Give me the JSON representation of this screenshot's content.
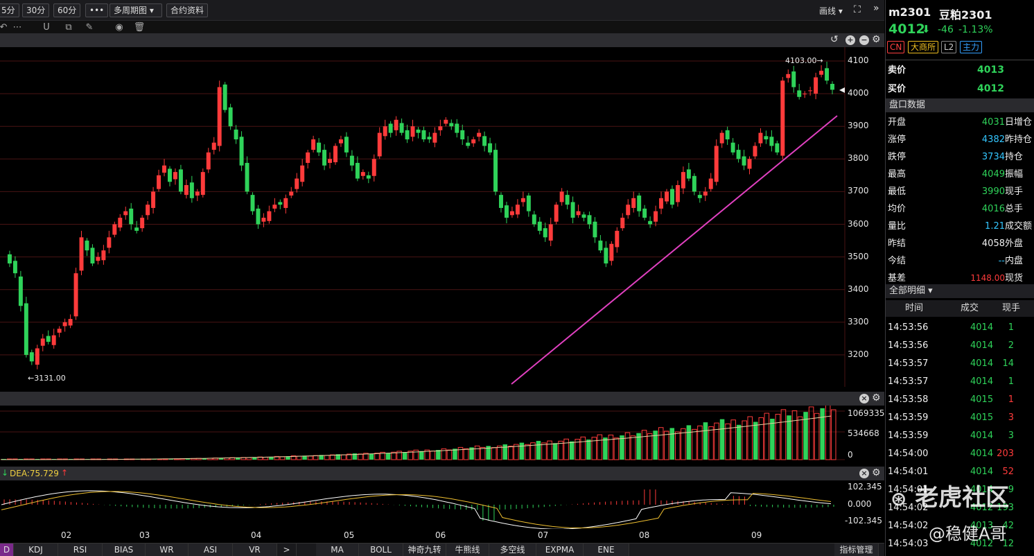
{
  "toolbar": {
    "buttons": [
      "5分",
      "30分",
      "60分",
      "•••",
      "多周期图",
      "合约资料"
    ],
    "draw_label": "画线",
    "more_label": "»"
  },
  "main_chart": {
    "price_ticks": [
      "4100",
      "4000",
      "3900",
      "3800",
      "3700",
      "3600",
      "3500",
      "3400",
      "3300",
      "3200"
    ],
    "high_label": "4103.00",
    "low_label": "3131.00",
    "x_ticks": [
      "02",
      "03",
      "04",
      "05",
      "06",
      "07",
      "08",
      "09"
    ]
  },
  "volume_panel": {
    "ticks": [
      "1069335",
      "534668",
      "0"
    ]
  },
  "macd_panel": {
    "dea_label": "DEA:75.729",
    "ticks": [
      "102.345",
      "0.000",
      "-102.345"
    ]
  },
  "bottom_tabs": {
    "left": [
      "D",
      "KDJ",
      "RSI",
      "BIAS",
      "WR",
      "ASI",
      "VR"
    ],
    "arrow": ">",
    "right": [
      "MA",
      "BOLL",
      "神奇九转",
      "牛熊线",
      "多空线",
      "EXPMA",
      "ENE"
    ],
    "manage": "指标管理"
  },
  "quote": {
    "code": "m2301",
    "name": "豆粕2301",
    "price": "4012",
    "change": "-46",
    "change_pct": "-1.13%",
    "tags": [
      "CN",
      "大商所",
      "L2",
      "主力"
    ],
    "sell_label": "卖价",
    "sell_value": "4013",
    "buy_label": "买价",
    "buy_value": "4012",
    "section_title": "盘口数据",
    "rows": [
      {
        "label": "开盘",
        "value": "4031",
        "right": "日增仓"
      },
      {
        "label": "涨停",
        "value": "4382",
        "right": "昨持仓"
      },
      {
        "label": "跌停",
        "value": "3734",
        "right": "持仓"
      },
      {
        "label": "最高",
        "value": "4049",
        "right": "振幅"
      },
      {
        "label": "最低",
        "value": "3990",
        "right": "现手"
      },
      {
        "label": "均价",
        "value": "4016",
        "right": "总手"
      },
      {
        "label": "量比",
        "value": "1.21",
        "right": "成交额"
      },
      {
        "label": "昨结",
        "value": "4058",
        "right": "外盘"
      },
      {
        "label": "今结",
        "value": "--",
        "right": "内盘"
      },
      {
        "label": "基差",
        "value": "1148.00",
        "right": "现货"
      }
    ],
    "trades_title": "全部明细",
    "trade_headers": [
      "时间",
      "成交",
      "现手"
    ],
    "trades": [
      {
        "time": "14:53:56",
        "price": "4014",
        "vol": "1"
      },
      {
        "time": "14:53:56",
        "price": "4014",
        "vol": "2"
      },
      {
        "time": "14:53:57",
        "price": "4014",
        "vol": "14"
      },
      {
        "time": "14:53:57",
        "price": "4014",
        "vol": "1"
      },
      {
        "time": "14:53:58",
        "price": "4015",
        "vol": "1"
      },
      {
        "time": "14:53:59",
        "price": "4015",
        "vol": "3"
      },
      {
        "time": "14:53:59",
        "price": "4014",
        "vol": "3"
      },
      {
        "time": "14:54:00",
        "price": "4014",
        "vol": "203"
      },
      {
        "time": "14:54:01",
        "price": "4014",
        "vol": "52"
      },
      {
        "time": "14:54:01",
        "price": "4014",
        "vol": "9"
      },
      {
        "time": "14:54:02",
        "price": "4012",
        "vol": "193"
      },
      {
        "time": "14:54:02",
        "price": "4013",
        "vol": "42"
      },
      {
        "time": "14:54:03",
        "price": "4012",
        "vol": "12"
      }
    ]
  },
  "watermark": {
    "brand": "老虎社区",
    "author": "@稳健A哥"
  },
  "colors": {
    "up": "#ff3b3b",
    "down": "#2fd35a",
    "trendline": "#e040c0",
    "grid": "#5a1a1a"
  }
}
